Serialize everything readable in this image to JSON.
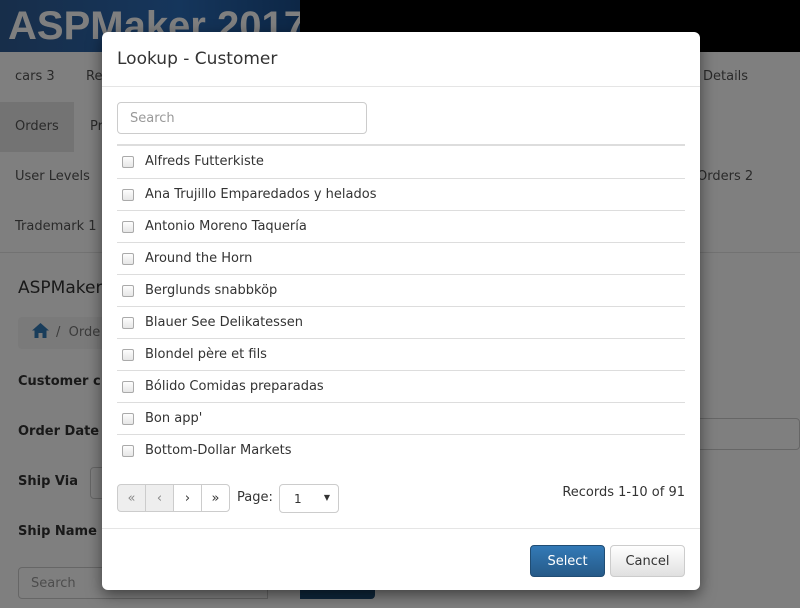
{
  "app": {
    "logo_text": "ASPMaker 2017",
    "nav_rows": [
      {
        "items": [
          {
            "label": "cars 3",
            "active": false
          },
          {
            "label": "Re",
            "active": false
          },
          {
            "label": "Details",
            "active": false
          }
        ]
      },
      {
        "items": [
          {
            "label": "Orders",
            "active": true
          },
          {
            "label": "Pr",
            "active": false
          }
        ]
      },
      {
        "items": [
          {
            "label": "User Levels",
            "active": false
          },
          {
            "label": "Orders 2",
            "active": false
          }
        ]
      },
      {
        "items": [
          {
            "label": "Trademark 1",
            "active": false
          }
        ]
      }
    ],
    "page_title": "ASPMaker",
    "breadcrumb_item": "Orde",
    "form_labels": [
      "Customer c",
      "Order Date",
      "Ship Via",
      "Ship Name"
    ],
    "search_placeholder": "Search"
  },
  "modal": {
    "title": "Lookup - Customer",
    "search_placeholder": "Search",
    "items": [
      "Alfreds Futterkiste",
      "Ana Trujillo Emparedados y helados",
      "Antonio Moreno Taquería",
      "Around the Horn",
      "Berglunds snabbköp",
      "Blauer See Delikatessen",
      "Blondel père et fils",
      "Bólido Comidas preparadas",
      "Bon app'",
      "Bottom-Dollar Markets"
    ],
    "pager": {
      "first_icon": "«",
      "prev_icon": "‹",
      "next_icon": "›",
      "last_icon": "»",
      "page_label": "Page:",
      "page_value": "1",
      "records_text": "Records 1-10 of 91"
    },
    "select_label": "Select",
    "cancel_label": "Cancel"
  },
  "colors": {
    "primary": "#337ab7",
    "overlay": "rgba(0,0,0,0.5)"
  }
}
